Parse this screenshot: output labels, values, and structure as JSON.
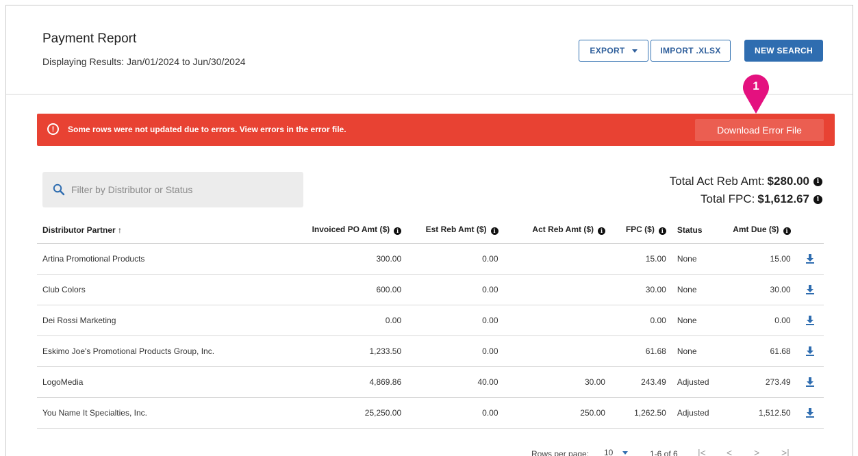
{
  "header": {
    "title": "Payment Report",
    "subtitle": "Displaying Results: Jan/01/2024 to Jun/30/2024",
    "export_label": "EXPORT",
    "import_label": "IMPORT .XLSX",
    "new_search_label": "NEW SEARCH"
  },
  "callout": {
    "number": "1",
    "color": "#e4117f"
  },
  "error_banner": {
    "icon": "alert-circle-icon",
    "message": "Some rows were not updated due to errors. View errors in the error file.",
    "button_label": "Download Error File",
    "color": "#e84233"
  },
  "search": {
    "placeholder": "Filter by Distributor or Status"
  },
  "totals": {
    "act_reb_label": "Total Act Reb Amt:",
    "act_reb_value": "$280.00",
    "fpc_label": "Total FPC:",
    "fpc_value": "$1,612.67"
  },
  "table": {
    "headers": {
      "distributor": "Distributor Partner",
      "invoiced": "Invoiced PO Amt ($)",
      "est_reb": "Est Reb Amt ($)",
      "act_reb": "Act Reb Amt ($)",
      "fpc": "FPC ($)",
      "status": "Status",
      "amt_due": "Amt Due ($)"
    },
    "sort_indicator": "↑",
    "rows": [
      {
        "distributor": "Artina Promotional Products",
        "invoiced": "300.00",
        "est_reb": "0.00",
        "act_reb": "",
        "fpc": "15.00",
        "status": "None",
        "amt_due": "15.00"
      },
      {
        "distributor": "Club Colors",
        "invoiced": "600.00",
        "est_reb": "0.00",
        "act_reb": "",
        "fpc": "30.00",
        "status": "None",
        "amt_due": "30.00"
      },
      {
        "distributor": "Dei Rossi Marketing",
        "invoiced": "0.00",
        "est_reb": "0.00",
        "act_reb": "",
        "fpc": "0.00",
        "status": "None",
        "amt_due": "0.00"
      },
      {
        "distributor": "Eskimo Joe's Promotional Products Group, Inc.",
        "invoiced": "1,233.50",
        "est_reb": "0.00",
        "act_reb": "",
        "fpc": "61.68",
        "status": "None",
        "amt_due": "61.68"
      },
      {
        "distributor": "LogoMedia",
        "invoiced": "4,869.86",
        "est_reb": "40.00",
        "act_reb": "30.00",
        "fpc": "243.49",
        "status": "Adjusted",
        "amt_due": "273.49"
      },
      {
        "distributor": "You Name It Specialties, Inc.",
        "invoiced": "25,250.00",
        "est_reb": "0.00",
        "act_reb": "250.00",
        "fpc": "1,262.50",
        "status": "Adjusted",
        "amt_due": "1,512.50"
      }
    ]
  },
  "pagination": {
    "rows_per_page_label": "Rows per page:",
    "rows_per_page_value": "10",
    "range": "1-6 of 6",
    "first": "|<",
    "prev": "<",
    "next": ">",
    "last": ">|"
  }
}
